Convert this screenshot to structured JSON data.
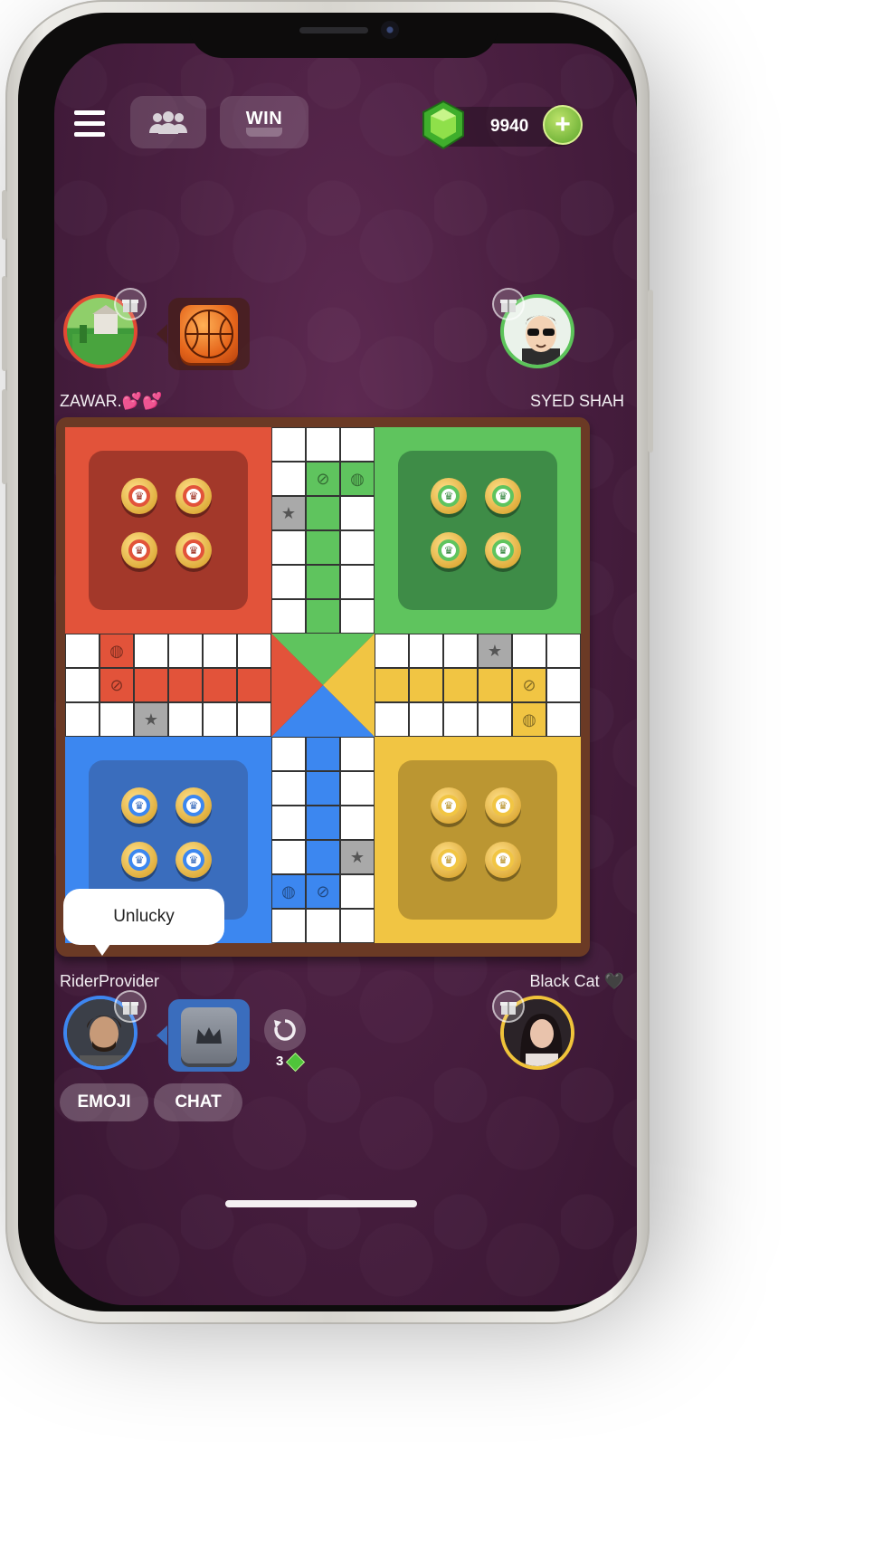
{
  "topbar": {
    "menu_icon": "hamburger-menu-icon",
    "friends_icon": "friends-group-icon",
    "win_label": "WIN",
    "gems": "9940",
    "gem_icon": "green-gem-icon",
    "add_icon": "plus-icon"
  },
  "players": {
    "top_left": {
      "name": "ZAWAR.💕💕",
      "ring_color": "#e24a33",
      "dice": "basketball-dice-icon"
    },
    "top_right": {
      "name": "SYED  SHAH",
      "ring_color": "#5cc35a"
    },
    "bottom_left": {
      "name": "RiderProvider",
      "ring_color": "#3d86f0",
      "dice": "crown-dice-icon"
    },
    "bottom_right": {
      "name": "Black Cat 🖤",
      "ring_color": "#f0c33a"
    }
  },
  "bubble": {
    "text": "Unlucky"
  },
  "controls": {
    "refresh_cost": "3",
    "emoji_label": "EMOJI",
    "chat_label": "CHAT"
  },
  "colors": {
    "red": "#e2533a",
    "red_dark": "#a3382a",
    "green": "#5fc45e",
    "green_dark": "#3e8c47",
    "blue": "#3c87f0",
    "blue_dark": "#3a6dbd",
    "yellow": "#f1c543",
    "yellow_dark": "#bb9632",
    "background": "#4a1f41"
  }
}
